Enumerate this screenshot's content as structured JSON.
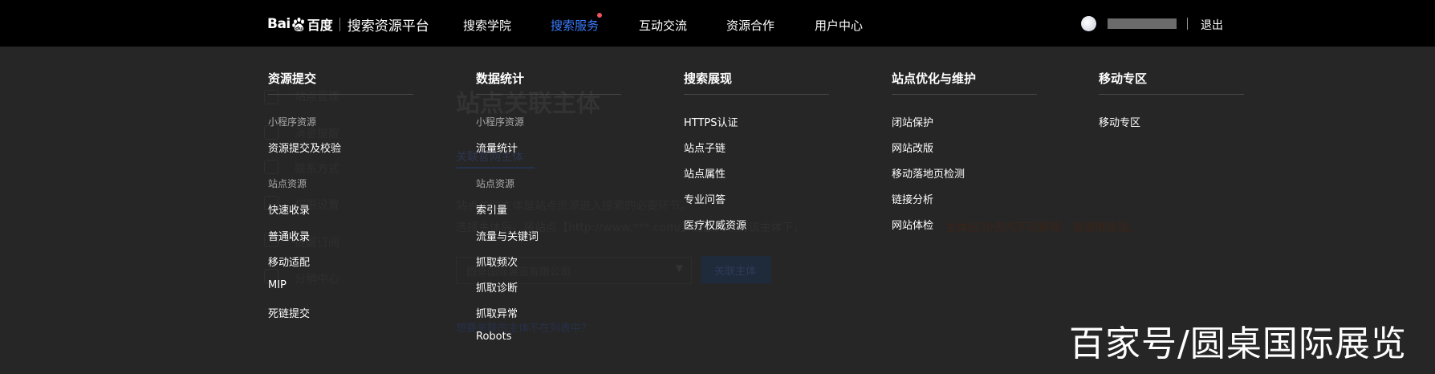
{
  "header": {
    "logo_text": "Bai百度",
    "logo_wordmark_bai": "Bai",
    "logo_wordmark_cn": "百度",
    "product_name": "搜索资源平台",
    "nav": [
      {
        "label": "搜索学院"
      },
      {
        "label": "搜索服务",
        "active": true,
        "has_notification_dot": true
      },
      {
        "label": "互动交流"
      },
      {
        "label": "资源合作"
      },
      {
        "label": "用户中心"
      }
    ],
    "logout_label": "退出"
  },
  "dropdown": {
    "columns": [
      {
        "heading": "资源提交",
        "entries": [
          {
            "kind": "group",
            "label": "小程序资源"
          },
          {
            "kind": "link",
            "label": "资源提交及校验"
          },
          {
            "kind": "group",
            "label": "站点资源"
          },
          {
            "kind": "link",
            "label": "快速收录"
          },
          {
            "kind": "link",
            "label": "普通收录"
          },
          {
            "kind": "link",
            "label": "移动适配"
          },
          {
            "kind": "link",
            "label": "MIP"
          },
          {
            "kind": "link",
            "label": "死链提交"
          }
        ]
      },
      {
        "heading": "数据统计",
        "entries": [
          {
            "kind": "group",
            "label": "小程序资源"
          },
          {
            "kind": "link",
            "label": "流量统计"
          },
          {
            "kind": "group",
            "label": "站点资源"
          },
          {
            "kind": "link",
            "label": "索引量"
          },
          {
            "kind": "link",
            "label": "流量与关键词"
          },
          {
            "kind": "link",
            "label": "抓取频次"
          },
          {
            "kind": "link",
            "label": "抓取诊断"
          },
          {
            "kind": "link",
            "label": "抓取异常"
          },
          {
            "kind": "link",
            "label": "Robots"
          }
        ]
      },
      {
        "heading": "搜索展现",
        "entries": [
          {
            "kind": "link",
            "label": "HTTPS认证"
          },
          {
            "kind": "link",
            "label": "站点子链"
          },
          {
            "kind": "link",
            "label": "站点属性"
          },
          {
            "kind": "link",
            "label": "专业问答"
          },
          {
            "kind": "link",
            "label": "医疗权威资源"
          }
        ]
      },
      {
        "heading": "站点优化与维护",
        "entries": [
          {
            "kind": "link",
            "label": "闭站保护"
          },
          {
            "kind": "link",
            "label": "网站改版"
          },
          {
            "kind": "link",
            "label": "移动落地页检测"
          },
          {
            "kind": "link",
            "label": "链接分析"
          },
          {
            "kind": "link",
            "label": "网站体检"
          }
        ]
      },
      {
        "heading": "移动专区",
        "entries": [
          {
            "kind": "link",
            "label": "移动专区"
          }
        ]
      }
    ]
  },
  "background_page": {
    "sidebar": [
      "站点管理",
      "消息提醒",
      "联系方式",
      "权限设置",
      "提醒订阅",
      "分销中心"
    ],
    "title": "站点关联主体",
    "tab": "关联官网主体",
    "desc1": "站点关联主体是站点资源进入搜索的必要环节。",
    "desc2": "选择主体后，将站点【http://www.***.com/】直接关联到该主体下，",
    "warning": "主体后30天内不可解除，请谨慎处理。",
    "select_value": "圆桌国际展览有限公司",
    "button": "关联主体",
    "link": "想要关联的主体不在列表中？"
  },
  "watermark": "百家号/圆桌国际展览",
  "colors": {
    "topbar": "#000000",
    "overlay": "#262626",
    "accent": "#3b7cff",
    "notification": "#f0555a",
    "warning_text": "#3a2418"
  }
}
